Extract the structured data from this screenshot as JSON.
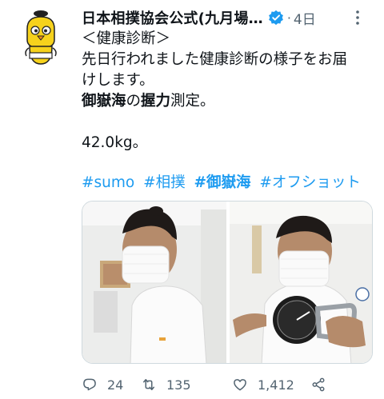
{
  "header": {
    "display_name": "日本相撲協会公式(九月場…",
    "separator": "·",
    "time": "4日"
  },
  "body": {
    "line1": "＜健康診断＞",
    "line2": "先日行われました健康診断の様子をお届",
    "line3": "けします。",
    "line4_bold1": "御嶽海",
    "line4_mid": "の",
    "line4_bold2": "握力",
    "line4_end": "測定。",
    "line5": "42.0kg。"
  },
  "hashtags": [
    {
      "label": "#sumo"
    },
    {
      "label": "#相撲"
    },
    {
      "label": "#御嶽海"
    },
    {
      "label": "#オフショット"
    }
  ],
  "actions": {
    "reply_count": "24",
    "retweet_count": "135",
    "like_count": "1,412"
  },
  "colors": {
    "accent": "#1d9bf0",
    "secondary_text": "#536471",
    "primary_text": "#0f1419"
  },
  "icons": [
    "avatar-mascot",
    "verified-badge-icon",
    "more-options-icon",
    "reply-icon",
    "retweet-icon",
    "like-icon",
    "share-icon"
  ]
}
